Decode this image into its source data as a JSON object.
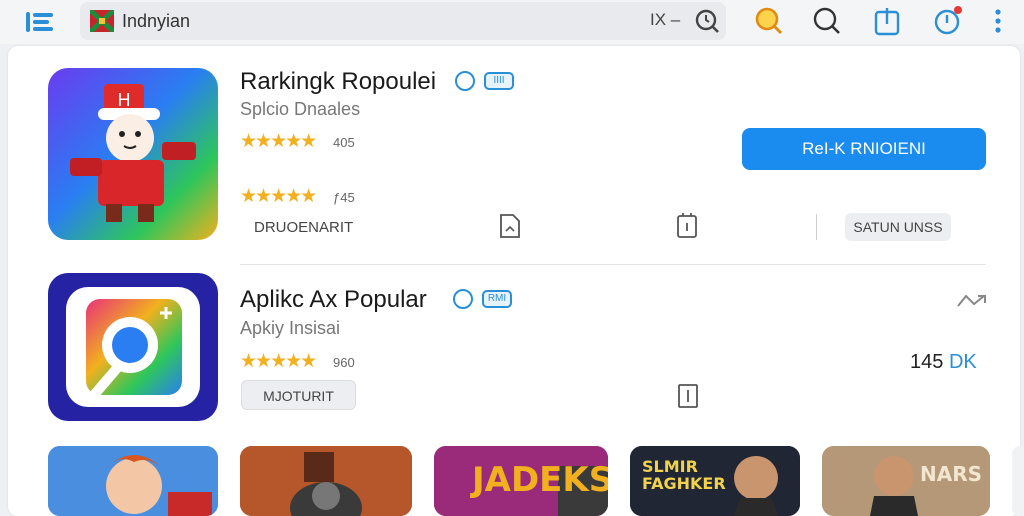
{
  "topbar": {
    "address_text": "Indnyian",
    "clear_label": "IX –"
  },
  "apps": [
    {
      "title": "Rarkingk Ropoulei",
      "badge": "IIII",
      "subtitle": "Splcio Dnaales",
      "rating_1": "405",
      "rating_2": "ƒ45",
      "stars_1": "★★★★★",
      "stars_2": "★★★★★",
      "tag_label": "DRUOENARIT",
      "action_button": "ReI-K RNIOIENI",
      "secondary_button": "SATUN UNSS"
    },
    {
      "title": "Aplikc Ax Popular",
      "badge": "RMI",
      "subtitle": "Apkiy Insisai",
      "rating": "960",
      "stars": "★★★★★",
      "tag_label": "MJOTURIT",
      "price": "145",
      "price_unit": "DK"
    }
  ],
  "thumbnails": [
    {
      "label": ""
    },
    {
      "label": ""
    },
    {
      "label": "JADEKS"
    },
    {
      "label": "SLMIR FAGHKER"
    },
    {
      "label": "NARS"
    }
  ],
  "colors": {
    "accent": "#1a8cf0",
    "star": "#f2b01e",
    "badge": "#2a8fd6"
  }
}
